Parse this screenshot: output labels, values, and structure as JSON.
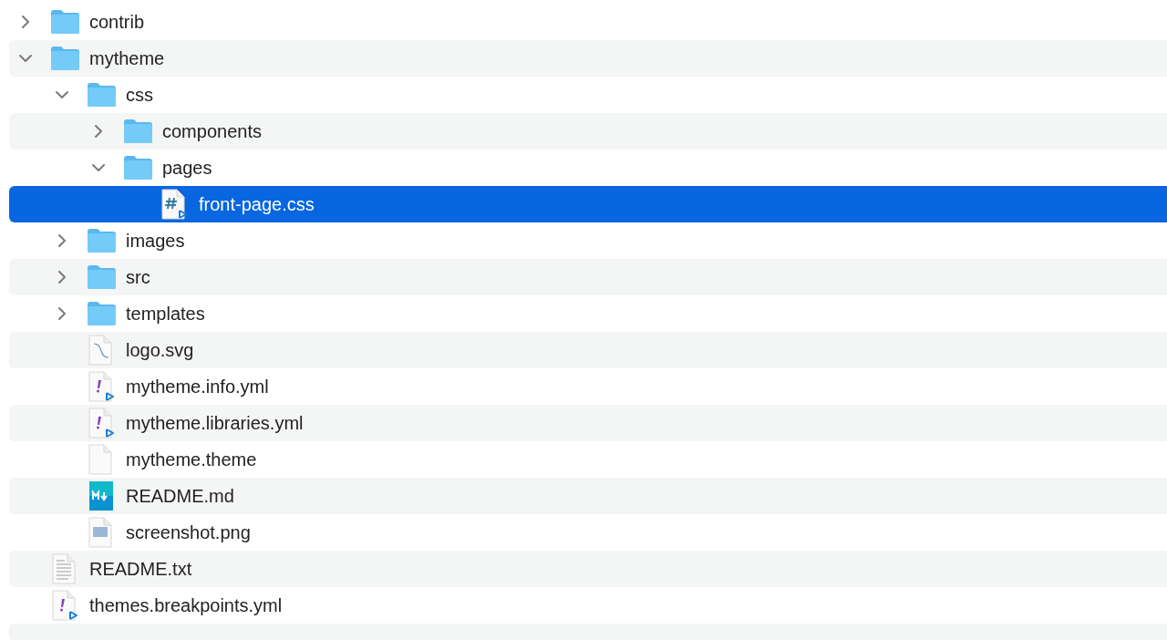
{
  "items": [
    {
      "kind": "folder",
      "name": "contrib",
      "expanded": false,
      "selected": false
    },
    {
      "kind": "folder",
      "name": "mytheme",
      "expanded": true,
      "selected": false,
      "children": [
        {
          "kind": "folder",
          "name": "css",
          "expanded": true,
          "selected": false,
          "children": [
            {
              "kind": "folder",
              "name": "components",
              "expanded": false,
              "selected": false
            },
            {
              "kind": "folder",
              "name": "pages",
              "expanded": true,
              "selected": false,
              "children": [
                {
                  "kind": "css",
                  "name": "front-page.css",
                  "selected": true
                }
              ]
            }
          ]
        },
        {
          "kind": "folder",
          "name": "images",
          "expanded": false,
          "selected": false
        },
        {
          "kind": "folder",
          "name": "src",
          "expanded": false,
          "selected": false
        },
        {
          "kind": "folder",
          "name": "templates",
          "expanded": false,
          "selected": false
        },
        {
          "kind": "svg",
          "name": "logo.svg",
          "selected": false
        },
        {
          "kind": "yml",
          "name": "mytheme.info.yml",
          "selected": false
        },
        {
          "kind": "yml",
          "name": "mytheme.libraries.yml",
          "selected": false
        },
        {
          "kind": "plain",
          "name": "mytheme.theme",
          "selected": false
        },
        {
          "kind": "md",
          "name": "README.md",
          "selected": false
        },
        {
          "kind": "png",
          "name": "screenshot.png",
          "selected": false
        }
      ]
    },
    {
      "kind": "txt",
      "name": "README.txt",
      "selected": false
    },
    {
      "kind": "yml",
      "name": "themes.breakpoints.yml",
      "selected": false
    }
  ]
}
